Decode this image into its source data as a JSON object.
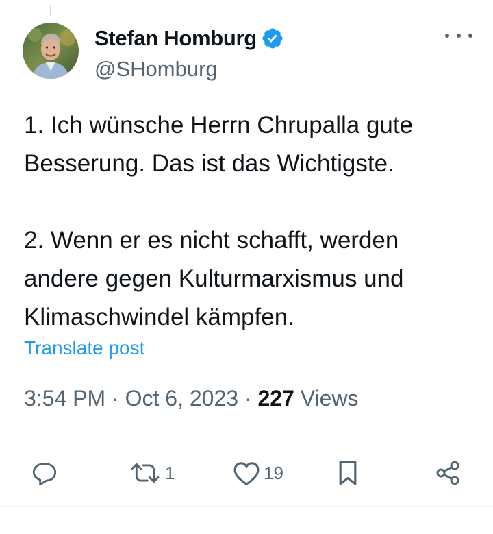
{
  "author": {
    "display_name": "Stefan Homburg",
    "handle": "@SHomburg",
    "verified": true,
    "avatar_icon": "person-photo"
  },
  "tweet": {
    "paragraphs": [
      "1. Ich wünsche Herrn Chrupalla gute Besserung. Das ist das Wichtigste.",
      "2. Wenn er es nicht schafft, werden andere gegen Kulturmarxismus und Klimaschwindel kämpfen."
    ],
    "translate_label": "Translate post"
  },
  "meta": {
    "time": "3:54 PM",
    "separator": " · ",
    "date": "Oct 6, 2023",
    "views_count": "227",
    "views_label": "Views"
  },
  "actions": {
    "reply_count": "",
    "retweet_count": "1",
    "like_count": "19"
  },
  "colors": {
    "accent": "#1d9bf0",
    "text": "#0f1419",
    "muted": "#536471",
    "divider": "#eff3f4"
  }
}
